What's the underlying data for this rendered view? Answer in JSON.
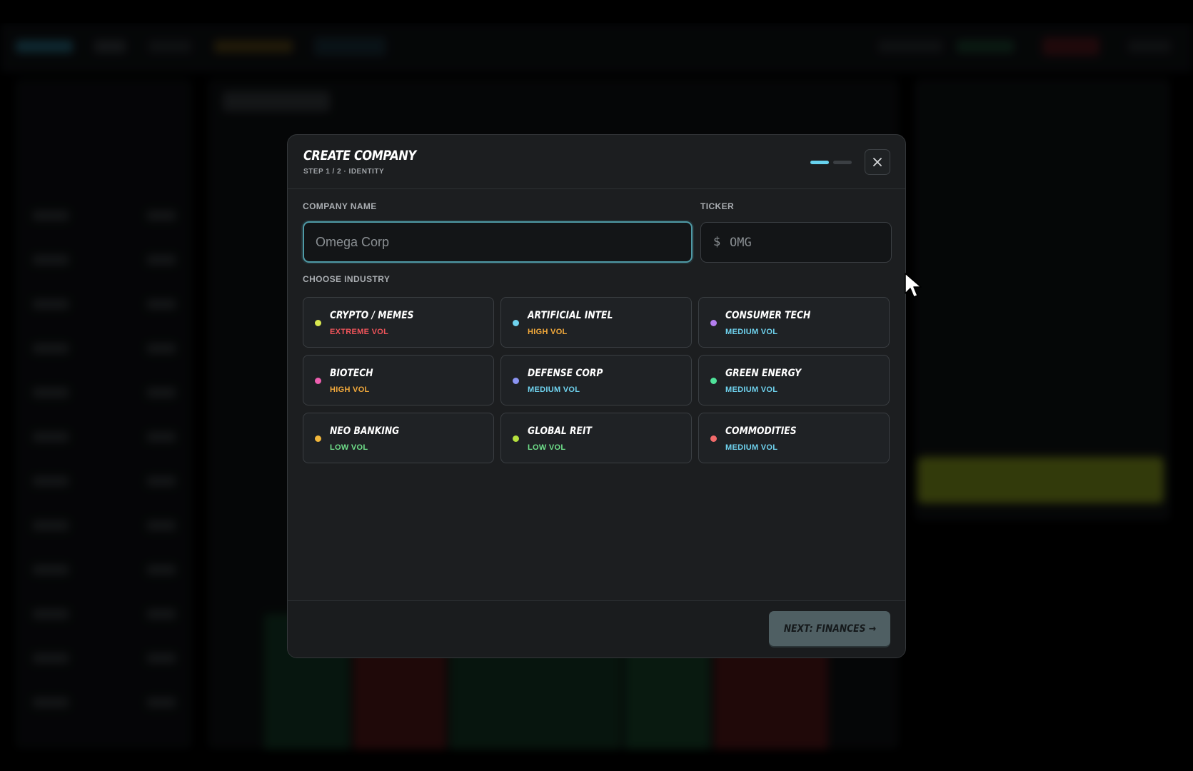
{
  "modal": {
    "title": "CREATE COMPANY",
    "subtitle": "STEP 1 / 2 · IDENTITY",
    "company_name_label": "COMPANY NAME",
    "company_name_placeholder": "Omega Corp",
    "company_name_value": "",
    "ticker_label": "TICKER",
    "ticker_prefix": "$",
    "ticker_placeholder": "OMG",
    "industry_label": "CHOOSE INDUSTRY",
    "industries": [
      {
        "name": "CRYPTO / MEMES",
        "volatility": "EXTREME VOL",
        "dot_color": "#d9e84f",
        "vol_color": "#f0545a"
      },
      {
        "name": "ARTIFICIAL INTEL",
        "volatility": "HIGH VOL",
        "dot_color": "#6fd3ef",
        "vol_color": "#f2a93b"
      },
      {
        "name": "CONSUMER TECH",
        "volatility": "MEDIUM VOL",
        "dot_color": "#b47ef0",
        "vol_color": "#6fd3ef"
      },
      {
        "name": "BIOTECH",
        "volatility": "HIGH VOL",
        "dot_color": "#ee5fb0",
        "vol_color": "#f2a93b"
      },
      {
        "name": "DEFENSE CORP",
        "volatility": "MEDIUM VOL",
        "dot_color": "#8b94f2",
        "vol_color": "#6fd3ef"
      },
      {
        "name": "GREEN ENERGY",
        "volatility": "MEDIUM VOL",
        "dot_color": "#4fe39a",
        "vol_color": "#6fd3ef"
      },
      {
        "name": "NEO BANKING",
        "volatility": "LOW VOL",
        "dot_color": "#f2b73b",
        "vol_color": "#6fe08a"
      },
      {
        "name": "GLOBAL REIT",
        "volatility": "LOW VOL",
        "dot_color": "#b5e03e",
        "vol_color": "#6fe08a"
      },
      {
        "name": "COMMODITIES",
        "volatility": "MEDIUM VOL",
        "dot_color": "#f26a6a",
        "vol_color": "#6fd3ef"
      }
    ],
    "next_button": "NEXT: FINANCES →",
    "step_active_color": "#67d2ee"
  },
  "icons": {
    "close": "close-icon",
    "cursor": "cursor-icon"
  }
}
